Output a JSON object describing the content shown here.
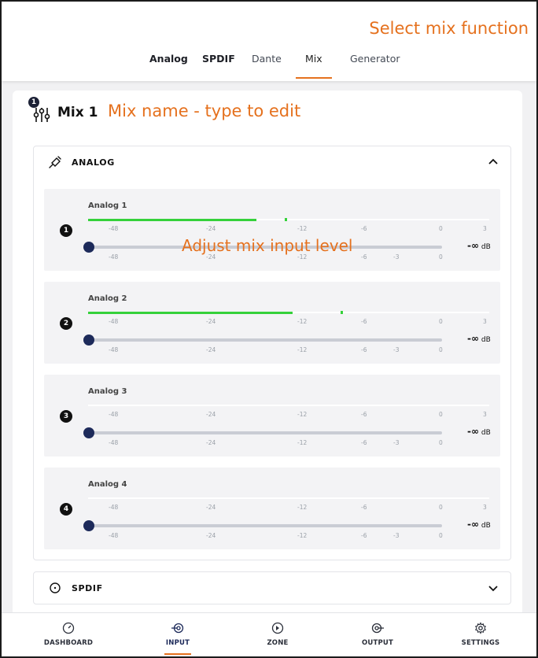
{
  "callouts": {
    "select_mix": "Select mix function",
    "mix_name": "Mix name - type to edit",
    "adjust_level": "Adjust mix input level"
  },
  "tabs": [
    {
      "label": "Analog",
      "active": false
    },
    {
      "label": "SPDIF",
      "active": false
    },
    {
      "label": "Dante",
      "active": false
    },
    {
      "label": "Mix",
      "active": true
    },
    {
      "label": "Generator",
      "active": false
    }
  ],
  "mix": {
    "badge": "1",
    "name": "Mix 1",
    "icon": "sliders-icon"
  },
  "sections": {
    "analog": {
      "label": "ANALOG",
      "icon": "cable-icon",
      "expanded": true
    },
    "spdif": {
      "label": "SPDIF",
      "icon": "circle-dot-icon",
      "expanded": false
    }
  },
  "meter_ticks": [
    "-48",
    "-24",
    "-12",
    "-6",
    "0",
    "3"
  ],
  "slider_ticks": [
    "-48",
    "-24",
    "-12",
    "-6",
    "-3",
    "0"
  ],
  "channels": [
    {
      "number": "1",
      "label": "Analog 1",
      "meter_level": 0.42,
      "peak": 0.49,
      "gain_text": "-∞",
      "unit": "dB"
    },
    {
      "number": "2",
      "label": "Analog 2",
      "meter_level": 0.51,
      "peak": 0.63,
      "gain_text": "-∞",
      "unit": "dB"
    },
    {
      "number": "3",
      "label": "Analog 3",
      "meter_level": 0,
      "peak": null,
      "gain_text": "-∞",
      "unit": "dB"
    },
    {
      "number": "4",
      "label": "Analog 4",
      "meter_level": 0,
      "peak": null,
      "gain_text": "-∞",
      "unit": "dB"
    }
  ],
  "bottom_nav": [
    {
      "label": "DASHBOARD",
      "icon": "gauge-icon",
      "active": false
    },
    {
      "label": "INPUT",
      "icon": "input-icon",
      "active": true
    },
    {
      "label": "ZONE",
      "icon": "zone-icon",
      "active": false
    },
    {
      "label": "OUTPUT",
      "icon": "output-icon",
      "active": false
    },
    {
      "label": "SETTINGS",
      "icon": "gear-icon",
      "active": false
    }
  ],
  "colors": {
    "accent": "#e5711e",
    "meter": "#35d13a",
    "knob": "#1d2a5a"
  }
}
